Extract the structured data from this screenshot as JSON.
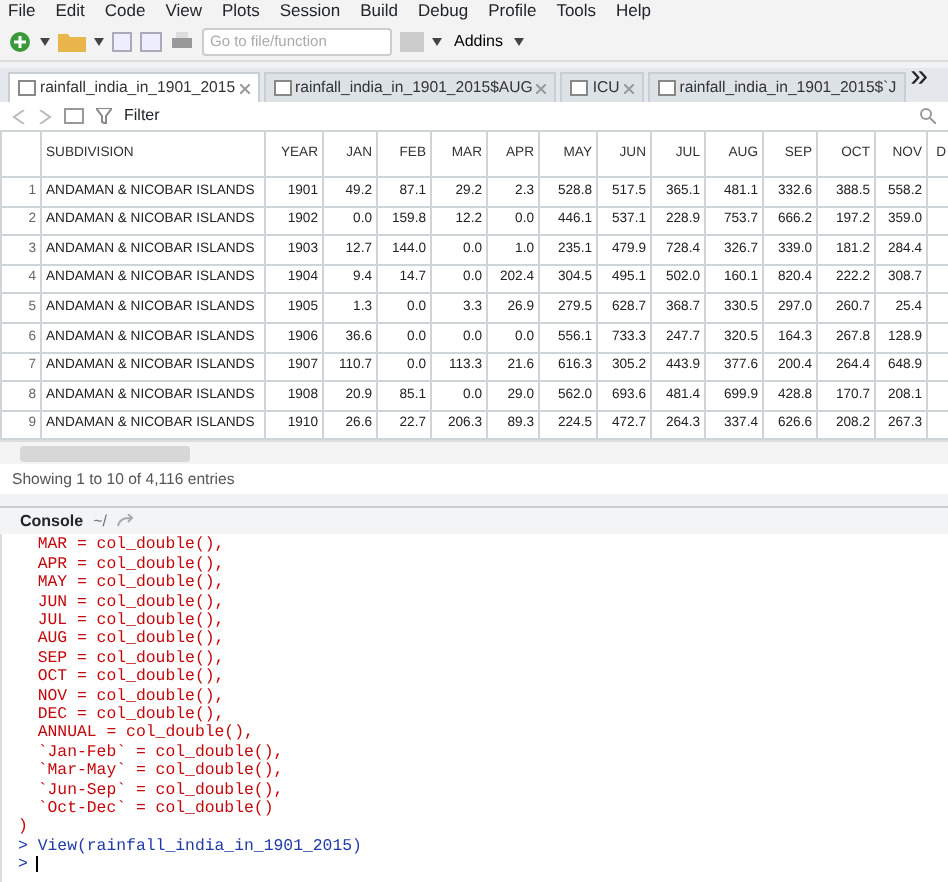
{
  "menu": [
    "File",
    "Edit",
    "Code",
    "View",
    "Plots",
    "Session",
    "Build",
    "Debug",
    "Profile",
    "Tools",
    "Help"
  ],
  "toolbar": {
    "goto_placeholder": "Go to file/function",
    "addins": "Addins"
  },
  "tabs": [
    {
      "label": "rainfall_india_in_1901_2015",
      "selected": true
    },
    {
      "label": "rainfall_india_in_1901_2015$AUG",
      "selected": false
    },
    {
      "label": "ICU",
      "selected": false
    },
    {
      "label": "rainfall_india_in_1901_2015$`J",
      "selected": false
    }
  ],
  "tab_overflow": "»",
  "filter_label": "Filter",
  "table": {
    "columns": [
      "",
      "SUBDIVISION",
      "YEAR",
      "JAN",
      "FEB",
      "MAR",
      "APR",
      "MAY",
      "JUN",
      "JUL",
      "AUG",
      "SEP",
      "OCT",
      "NOV",
      "D"
    ],
    "rows": [
      [
        "1",
        "ANDAMAN & NICOBAR ISLANDS",
        "1901",
        "49.2",
        "87.1",
        "29.2",
        "2.3",
        "528.8",
        "517.5",
        "365.1",
        "481.1",
        "332.6",
        "388.5",
        "558.2"
      ],
      [
        "2",
        "ANDAMAN & NICOBAR ISLANDS",
        "1902",
        "0.0",
        "159.8",
        "12.2",
        "0.0",
        "446.1",
        "537.1",
        "228.9",
        "753.7",
        "666.2",
        "197.2",
        "359.0"
      ],
      [
        "3",
        "ANDAMAN & NICOBAR ISLANDS",
        "1903",
        "12.7",
        "144.0",
        "0.0",
        "1.0",
        "235.1",
        "479.9",
        "728.4",
        "326.7",
        "339.0",
        "181.2",
        "284.4"
      ],
      [
        "4",
        "ANDAMAN & NICOBAR ISLANDS",
        "1904",
        "9.4",
        "14.7",
        "0.0",
        "202.4",
        "304.5",
        "495.1",
        "502.0",
        "160.1",
        "820.4",
        "222.2",
        "308.7"
      ],
      [
        "5",
        "ANDAMAN & NICOBAR ISLANDS",
        "1905",
        "1.3",
        "0.0",
        "3.3",
        "26.9",
        "279.5",
        "628.7",
        "368.7",
        "330.5",
        "297.0",
        "260.7",
        "25.4"
      ],
      [
        "6",
        "ANDAMAN & NICOBAR ISLANDS",
        "1906",
        "36.6",
        "0.0",
        "0.0",
        "0.0",
        "556.1",
        "733.3",
        "247.7",
        "320.5",
        "164.3",
        "267.8",
        "128.9"
      ],
      [
        "7",
        "ANDAMAN & NICOBAR ISLANDS",
        "1907",
        "110.7",
        "0.0",
        "113.3",
        "21.6",
        "616.3",
        "305.2",
        "443.9",
        "377.6",
        "200.4",
        "264.4",
        "648.9"
      ],
      [
        "8",
        "ANDAMAN & NICOBAR ISLANDS",
        "1908",
        "20.9",
        "85.1",
        "0.0",
        "29.0",
        "562.0",
        "693.6",
        "481.4",
        "699.9",
        "428.8",
        "170.7",
        "208.1"
      ],
      [
        "9",
        "ANDAMAN & NICOBAR ISLANDS",
        "1910",
        "26.6",
        "22.7",
        "206.3",
        "89.3",
        "224.5",
        "472.7",
        "264.3",
        "337.4",
        "626.6",
        "208.2",
        "267.3"
      ]
    ]
  },
  "table_info": "Showing 1 to 10 of 4,116 entries",
  "console": {
    "title": "Console",
    "path": "~/",
    "lines": [
      {
        "kind": "output",
        "text": "  MAR = col_double(),"
      },
      {
        "kind": "output",
        "text": "  APR = col_double(),"
      },
      {
        "kind": "output",
        "text": "  MAY = col_double(),"
      },
      {
        "kind": "output",
        "text": "  JUN = col_double(),"
      },
      {
        "kind": "output",
        "text": "  JUL = col_double(),"
      },
      {
        "kind": "output",
        "text": "  AUG = col_double(),"
      },
      {
        "kind": "output",
        "text": "  SEP = col_double(),"
      },
      {
        "kind": "output",
        "text": "  OCT = col_double(),"
      },
      {
        "kind": "output",
        "text": "  NOV = col_double(),"
      },
      {
        "kind": "output",
        "text": "  DEC = col_double(),"
      },
      {
        "kind": "output",
        "text": "  ANNUAL = col_double(),"
      },
      {
        "kind": "output",
        "text": "  `Jan-Feb` = col_double(),"
      },
      {
        "kind": "output",
        "text": "  `Mar-May` = col_double(),"
      },
      {
        "kind": "output",
        "text": "  `Jun-Sep` = col_double(),"
      },
      {
        "kind": "output",
        "text": "  `Oct-Dec` = col_double()"
      },
      {
        "kind": "output",
        "text": ")"
      },
      {
        "kind": "input",
        "text": "> View(rainfall_india_in_1901_2015)"
      },
      {
        "kind": "prompt",
        "text": ">"
      }
    ]
  }
}
